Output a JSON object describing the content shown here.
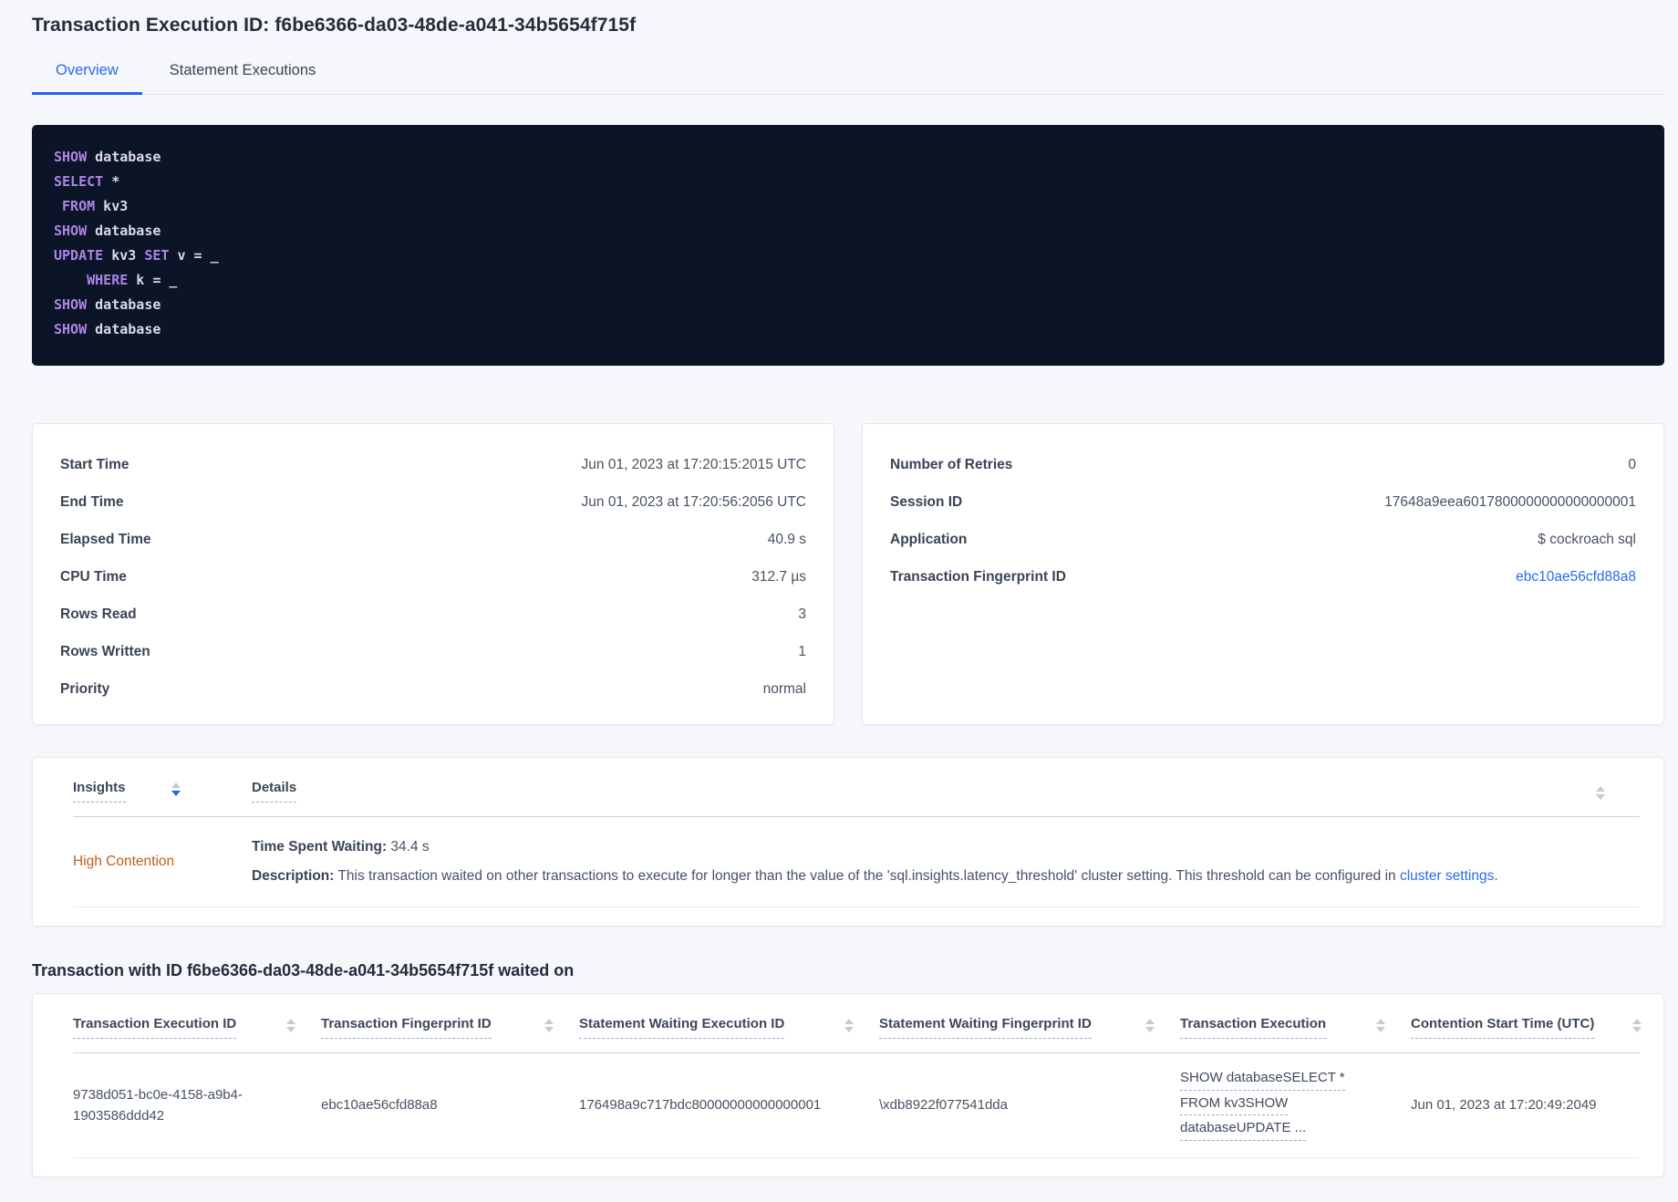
{
  "header": {
    "title": "Transaction Execution ID: f6be6366-da03-48de-a041-34b5654f715f",
    "tabs": [
      {
        "label": "Overview",
        "active": true
      },
      {
        "label": "Statement Executions",
        "active": false
      }
    ]
  },
  "sql_preview": {
    "lines": [
      {
        "tokens": [
          {
            "text": "SHOW",
            "type": "kw"
          },
          {
            "text": " database",
            "type": "id"
          }
        ]
      },
      {
        "tokens": [
          {
            "text": "SELECT",
            "type": "kw"
          },
          {
            "text": " *",
            "type": "id"
          }
        ]
      },
      {
        "tokens": [
          {
            "text": " ",
            "type": "id"
          },
          {
            "text": "FROM",
            "type": "kw"
          },
          {
            "text": " kv3",
            "type": "id"
          }
        ]
      },
      {
        "tokens": [
          {
            "text": "SHOW",
            "type": "kw"
          },
          {
            "text": " database",
            "type": "id"
          }
        ]
      },
      {
        "tokens": [
          {
            "text": "UPDATE",
            "type": "kw"
          },
          {
            "text": " kv3 ",
            "type": "id"
          },
          {
            "text": "SET",
            "type": "kw"
          },
          {
            "text": " v = _",
            "type": "id"
          }
        ]
      },
      {
        "tokens": [
          {
            "text": "    ",
            "type": "id"
          },
          {
            "text": "WHERE",
            "type": "kw"
          },
          {
            "text": " k = _",
            "type": "id"
          }
        ]
      },
      {
        "tokens": [
          {
            "text": "SHOW",
            "type": "kw"
          },
          {
            "text": " database",
            "type": "id"
          }
        ]
      },
      {
        "tokens": [
          {
            "text": "SHOW",
            "type": "kw"
          },
          {
            "text": " database",
            "type": "id"
          }
        ]
      }
    ]
  },
  "summary_left": {
    "rows": [
      {
        "label": "Start Time",
        "value": "Jun 01, 2023 at 17:20:15:2015 UTC"
      },
      {
        "label": "End Time",
        "value": "Jun 01, 2023 at 17:20:56:2056 UTC"
      },
      {
        "label": "Elapsed Time",
        "value": "40.9 s"
      },
      {
        "label": "CPU Time",
        "value": "312.7 µs"
      },
      {
        "label": "Rows Read",
        "value": "3"
      },
      {
        "label": "Rows Written",
        "value": "1"
      },
      {
        "label": "Priority",
        "value": "normal"
      }
    ]
  },
  "summary_right": {
    "rows": [
      {
        "label": "Number of Retries",
        "value": "0"
      },
      {
        "label": "Session ID",
        "value": "17648a9eea6017800000000000000001"
      },
      {
        "label": "Application",
        "value": "$ cockroach sql"
      },
      {
        "label": "Transaction Fingerprint ID",
        "value": "ebc10ae56cfd88a8"
      }
    ]
  },
  "insights": {
    "columns": {
      "insights": "Insights",
      "details": "Details"
    },
    "row": {
      "insight": "High Contention",
      "waiting_label": "Time Spent Waiting:",
      "waiting_value": " 34.4 s",
      "description_label": "Description:",
      "description_text": " This transaction waited on other transactions to execute for longer than the value of the 'sql.insights.latency_threshold' cluster setting. This threshold can be configured in ",
      "description_link": "cluster settings",
      "description_end": "."
    }
  },
  "waited_on": {
    "heading": "Transaction with ID f6be6366-da03-48de-a041-34b5654f715f waited on",
    "columns": [
      "Transaction Execution ID",
      "Transaction Fingerprint ID",
      "Statement Waiting Execution ID",
      "Statement Waiting Fingerprint ID",
      "Transaction Execution",
      "Contention Start Time (UTC)"
    ],
    "row": {
      "transaction_execution_id": "9738d051-bc0e-4158-a9b4-1903586ddd42",
      "transaction_fingerprint_id": "ebc10ae56cfd88a8",
      "statement_waiting_execution_id": "176498a9c717bdc80000000000000001",
      "statement_waiting_fingerprint_id": "\\xdb8922f077541dda",
      "transaction_execution_lines": [
        "SHOW databaseSELECT *",
        "FROM kv3SHOW",
        "databaseUPDATE ..."
      ],
      "contention_start_time": "Jun 01, 2023 at 17:20:49:2049"
    }
  },
  "colors": {
    "accent_blue": "#2563eb",
    "link_blue": "#2a6be8",
    "insight_orange": "#c15e19",
    "sql_keyword": "#ad85e6",
    "sql_identifier": "#dbd8f0",
    "sql_background": "#0c1527"
  }
}
